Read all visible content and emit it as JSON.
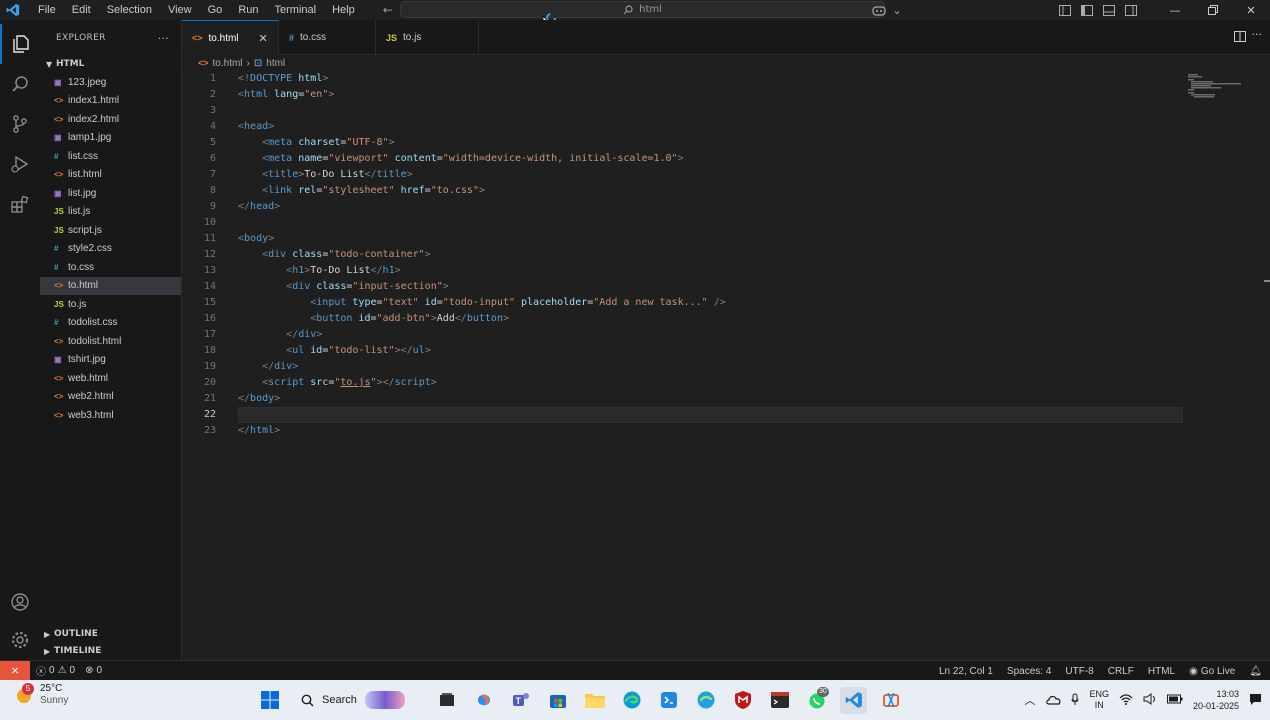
{
  "titlebar": {
    "menu": [
      "File",
      "Edit",
      "Selection",
      "View",
      "Go",
      "Run",
      "Terminal",
      "Help"
    ],
    "search_text": "html"
  },
  "explorer": {
    "title": "EXPLORER",
    "folder": "HTML",
    "files": [
      {
        "name": "123.jpeg",
        "type": "img"
      },
      {
        "name": "index1.html",
        "type": "html"
      },
      {
        "name": "index2.html",
        "type": "html"
      },
      {
        "name": "lamp1.jpg",
        "type": "img"
      },
      {
        "name": "list.css",
        "type": "css"
      },
      {
        "name": "list.html",
        "type": "html"
      },
      {
        "name": "list.jpg",
        "type": "img"
      },
      {
        "name": "list.js",
        "type": "js"
      },
      {
        "name": "script.js",
        "type": "js"
      },
      {
        "name": "style2.css",
        "type": "css"
      },
      {
        "name": "to.css",
        "type": "css"
      },
      {
        "name": "to.html",
        "type": "html",
        "selected": true
      },
      {
        "name": "to.js",
        "type": "js"
      },
      {
        "name": "todolist.css",
        "type": "css"
      },
      {
        "name": "todolist.html",
        "type": "html"
      },
      {
        "name": "tshirt.jpg",
        "type": "img"
      },
      {
        "name": "web.html",
        "type": "html"
      },
      {
        "name": "web2.html",
        "type": "html"
      },
      {
        "name": "web3.html",
        "type": "html"
      }
    ],
    "outline": "OUTLINE",
    "timeline": "TIMELINE"
  },
  "tabs": [
    {
      "label": "to.html",
      "type": "html",
      "active": true
    },
    {
      "label": "to.css",
      "type": "css",
      "active": false
    },
    {
      "label": "to.js",
      "type": "js",
      "active": false
    }
  ],
  "breadcrumb": {
    "file": "to.html",
    "symbol": "html"
  },
  "editor": {
    "current_line": 22,
    "lines": [
      [
        [
          "br",
          "<!"
        ],
        [
          "tag",
          "DOCTYPE"
        ],
        [
          "attr",
          " html"
        ],
        [
          "br",
          ">"
        ]
      ],
      [
        [
          "br",
          "<"
        ],
        [
          "tag",
          "html"
        ],
        [
          "attr",
          " lang"
        ],
        [
          "txt",
          "="
        ],
        [
          "str",
          "\"en\""
        ],
        [
          "br",
          ">"
        ]
      ],
      [],
      [
        [
          "br",
          "<"
        ],
        [
          "tag",
          "head"
        ],
        [
          "br",
          ">"
        ]
      ],
      [
        [
          "txt",
          "    "
        ],
        [
          "br",
          "<"
        ],
        [
          "tag",
          "meta"
        ],
        [
          "attr",
          " charset"
        ],
        [
          "txt",
          "="
        ],
        [
          "str",
          "\"UTF-8\""
        ],
        [
          "br",
          ">"
        ]
      ],
      [
        [
          "txt",
          "    "
        ],
        [
          "br",
          "<"
        ],
        [
          "tag",
          "meta"
        ],
        [
          "attr",
          " name"
        ],
        [
          "txt",
          "="
        ],
        [
          "str",
          "\"viewport\""
        ],
        [
          "attr",
          " content"
        ],
        [
          "txt",
          "="
        ],
        [
          "str",
          "\"width=device-width, initial-scale=1.0\""
        ],
        [
          "br",
          ">"
        ]
      ],
      [
        [
          "txt",
          "    "
        ],
        [
          "br",
          "<"
        ],
        [
          "tag",
          "title"
        ],
        [
          "br",
          ">"
        ],
        [
          "txt",
          "To-Do List"
        ],
        [
          "br",
          "</"
        ],
        [
          "tag",
          "title"
        ],
        [
          "br",
          ">"
        ]
      ],
      [
        [
          "txt",
          "    "
        ],
        [
          "br",
          "<"
        ],
        [
          "tag",
          "link"
        ],
        [
          "attr",
          " rel"
        ],
        [
          "txt",
          "="
        ],
        [
          "str",
          "\"stylesheet\""
        ],
        [
          "attr",
          " href"
        ],
        [
          "txt",
          "="
        ],
        [
          "str",
          "\"to.css\""
        ],
        [
          "br",
          ">"
        ]
      ],
      [
        [
          "br",
          "</"
        ],
        [
          "tag",
          "head"
        ],
        [
          "br",
          ">"
        ]
      ],
      [],
      [
        [
          "br",
          "<"
        ],
        [
          "tag",
          "body"
        ],
        [
          "br",
          ">"
        ]
      ],
      [
        [
          "txt",
          "    "
        ],
        [
          "br",
          "<"
        ],
        [
          "tag",
          "div"
        ],
        [
          "attr",
          " class"
        ],
        [
          "txt",
          "="
        ],
        [
          "str",
          "\"todo-container\""
        ],
        [
          "br",
          ">"
        ]
      ],
      [
        [
          "txt",
          "        "
        ],
        [
          "br",
          "<"
        ],
        [
          "tag",
          "h1"
        ],
        [
          "br",
          ">"
        ],
        [
          "txt",
          "To-Do List"
        ],
        [
          "br",
          "</"
        ],
        [
          "tag",
          "h1"
        ],
        [
          "br",
          ">"
        ]
      ],
      [
        [
          "txt",
          "        "
        ],
        [
          "br",
          "<"
        ],
        [
          "tag",
          "div"
        ],
        [
          "attr",
          " class"
        ],
        [
          "txt",
          "="
        ],
        [
          "str",
          "\"input-section\""
        ],
        [
          "br",
          ">"
        ]
      ],
      [
        [
          "txt",
          "            "
        ],
        [
          "br",
          "<"
        ],
        [
          "tag",
          "input"
        ],
        [
          "attr",
          " type"
        ],
        [
          "txt",
          "="
        ],
        [
          "str",
          "\"text\""
        ],
        [
          "attr",
          " id"
        ],
        [
          "txt",
          "="
        ],
        [
          "str",
          "\"todo-input\""
        ],
        [
          "attr",
          " placeholder"
        ],
        [
          "txt",
          "="
        ],
        [
          "str",
          "\"Add a new task...\""
        ],
        [
          "br",
          " />"
        ]
      ],
      [
        [
          "txt",
          "            "
        ],
        [
          "br",
          "<"
        ],
        [
          "tag",
          "button"
        ],
        [
          "attr",
          " id"
        ],
        [
          "txt",
          "="
        ],
        [
          "str",
          "\"add-btn\""
        ],
        [
          "br",
          ">"
        ],
        [
          "txt",
          "Add"
        ],
        [
          "br",
          "</"
        ],
        [
          "tag",
          "button"
        ],
        [
          "br",
          ">"
        ]
      ],
      [
        [
          "txt",
          "        "
        ],
        [
          "br",
          "</"
        ],
        [
          "tag",
          "div"
        ],
        [
          "br",
          ">"
        ]
      ],
      [
        [
          "txt",
          "        "
        ],
        [
          "br",
          "<"
        ],
        [
          "tag",
          "ul"
        ],
        [
          "attr",
          " id"
        ],
        [
          "txt",
          "="
        ],
        [
          "str",
          "\"todo-list\""
        ],
        [
          "br",
          ">"
        ],
        [
          "br",
          "</"
        ],
        [
          "tag",
          "ul"
        ],
        [
          "br",
          ">"
        ]
      ],
      [
        [
          "txt",
          "    "
        ],
        [
          "br",
          "</"
        ],
        [
          "tag",
          "div"
        ],
        [
          "br",
          ">"
        ]
      ],
      [
        [
          "txt",
          "    "
        ],
        [
          "br",
          "<"
        ],
        [
          "tag",
          "script"
        ],
        [
          "attr",
          " src"
        ],
        [
          "txt",
          "="
        ],
        [
          "str",
          "\""
        ],
        [
          "stru",
          "to.js"
        ],
        [
          "str",
          "\""
        ],
        [
          "br",
          ">"
        ],
        [
          "br",
          "</"
        ],
        [
          "tag",
          "script"
        ],
        [
          "br",
          ">"
        ]
      ],
      [
        [
          "br",
          "</"
        ],
        [
          "tag",
          "body"
        ],
        [
          "br",
          ">"
        ]
      ],
      [],
      [
        [
          "br",
          "</"
        ],
        [
          "tag",
          "html"
        ],
        [
          "br",
          ">"
        ]
      ]
    ]
  },
  "statusbar": {
    "errors": "0",
    "warnings": "0",
    "ports": "0",
    "position": "Ln 22, Col 1",
    "spaces": "Spaces: 4",
    "encoding": "UTF-8",
    "eol": "CRLF",
    "language": "HTML",
    "golive": "Go Live"
  },
  "taskbar": {
    "weather_badge": "5",
    "temperature": "25°C",
    "condition": "Sunny",
    "search": "Search",
    "whatsapp_badge": "30",
    "lang_top": "ENG",
    "lang_bottom": "IN",
    "time": "13:03",
    "date": "20-01-2025"
  },
  "colors": {
    "accent": "#0078d4",
    "remote": "#e8543a",
    "html_icon": "#e37933",
    "css_icon": "#519aba",
    "js_icon": "#cbcb41",
    "img_icon": "#a074c4"
  }
}
